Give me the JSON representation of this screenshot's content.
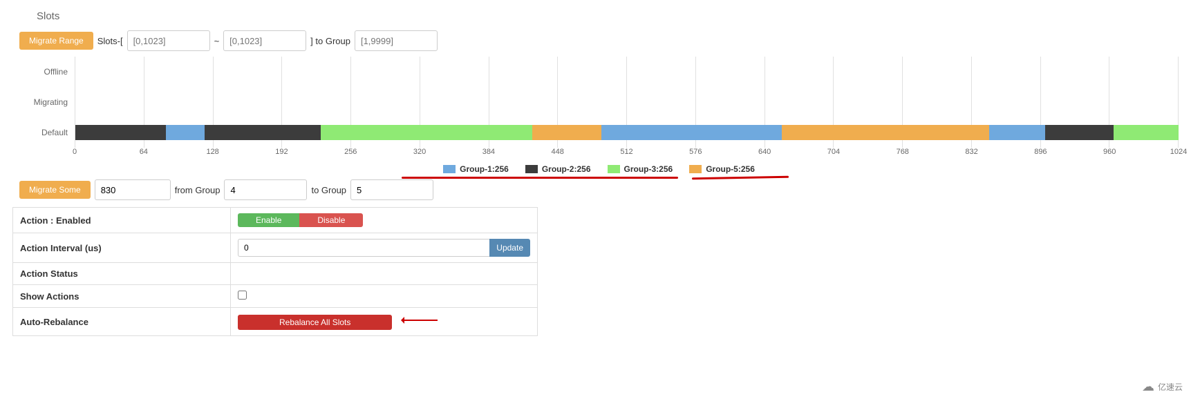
{
  "title": "Slots",
  "migrate_range": {
    "button": "Migrate Range",
    "prefix": "Slots-[",
    "from_placeholder": "[0,1023]",
    "sep": "~",
    "to_placeholder": "[0,1023]",
    "suffix": "] to Group",
    "group_placeholder": "[1,9999]"
  },
  "chart_data": {
    "type": "bar",
    "xlabel": "",
    "ylabel": "",
    "xlim": [
      0,
      1024
    ],
    "rows": [
      "Offline",
      "Migrating",
      "Default"
    ],
    "ticks": [
      0,
      64,
      128,
      192,
      256,
      320,
      384,
      448,
      512,
      576,
      640,
      704,
      768,
      832,
      896,
      960,
      1024
    ],
    "series": [
      {
        "name": "Group-1",
        "count": 256,
        "color": "#6fa9de"
      },
      {
        "name": "Group-2",
        "count": 256,
        "color": "#3c3c3c"
      },
      {
        "name": "Group-3",
        "count": 256,
        "color": "#8fea74"
      },
      {
        "name": "Group-5",
        "count": 256,
        "color": "#f0ad4e"
      }
    ],
    "default_bar_segments": [
      {
        "group": "Group-2",
        "width": 84,
        "color": "#3c3c3c"
      },
      {
        "group": "Group-1",
        "width": 36,
        "color": "#6fa9de"
      },
      {
        "group": "Group-2",
        "width": 108,
        "color": "#3c3c3c"
      },
      {
        "group": "Group-3",
        "width": 196,
        "color": "#8fea74"
      },
      {
        "group": "Group-5",
        "width": 64,
        "color": "#f0ad4e"
      },
      {
        "group": "Group-1",
        "width": 168,
        "color": "#6fa9de"
      },
      {
        "group": "Group-5",
        "width": 192,
        "color": "#f0ad4e"
      },
      {
        "group": "Group-1",
        "width": 52,
        "color": "#6fa9de"
      },
      {
        "group": "Group-2",
        "width": 64,
        "color": "#3c3c3c"
      },
      {
        "group": "Group-3",
        "width": 60,
        "color": "#8fea74"
      }
    ]
  },
  "migrate_some": {
    "button": "Migrate Some",
    "count_value": "830",
    "from_label": "from Group",
    "from_value": "4",
    "to_label": "to Group",
    "to_value": "5"
  },
  "settings": {
    "action_label": "Action : Enabled",
    "enable": "Enable",
    "disable": "Disable",
    "interval_label": "Action Interval (us)",
    "interval_value": "0",
    "update": "Update",
    "status_label": "Action Status",
    "show_actions_label": "Show Actions",
    "auto_rebalance_label": "Auto-Rebalance",
    "rebalance_button": "Rebalance All Slots"
  },
  "watermark": "亿速云"
}
